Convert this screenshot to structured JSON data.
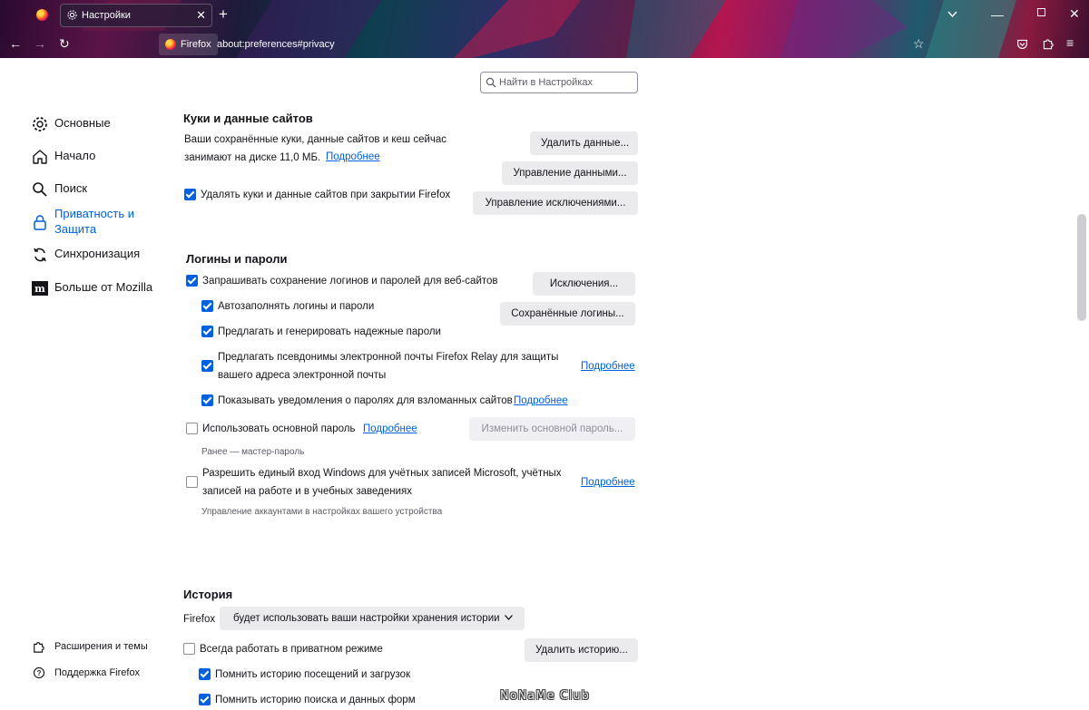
{
  "browser": {
    "tab_title": "Настройки",
    "identity_label": "Firefox",
    "url": "about:preferences#privacy"
  },
  "sidebar": {
    "items": [
      {
        "label": "Основные",
        "icon": "gear-icon"
      },
      {
        "label": "Начало",
        "icon": "home-icon"
      },
      {
        "label": "Поиск",
        "icon": "search-icon"
      },
      {
        "label": "Приватность и\nЗащита",
        "icon": "lock-icon",
        "selected": true
      },
      {
        "label": "Синхронизация",
        "icon": "sync-icon"
      },
      {
        "label": "Больше от Mozilla",
        "icon": "mozilla-icon"
      }
    ],
    "footer": [
      {
        "label": "Расширения и темы",
        "icon": "puzzle-icon"
      },
      {
        "label": "Поддержка Firefox",
        "icon": "help-icon"
      }
    ]
  },
  "search": {
    "placeholder": "Найти в Настройках"
  },
  "cookies": {
    "heading": "Куки и данные сайтов",
    "usage_line1": "Ваши сохранённые куки, данные сайтов и кеш сейчас",
    "usage_line2": "занимают на диске 11,0 МБ.",
    "learn_more": "Подробнее",
    "clear_data_button": "Удалить данные...",
    "manage_data_button": "Управление данными...",
    "manage_exceptions_button": "Управление исключениями...",
    "delete_on_close_label": "Удалять куки и данные сайтов при закрытии Firefox",
    "delete_on_close_checked": true
  },
  "logins": {
    "heading": "Логины и пароли",
    "ask_to_save_label": "Запрашивать сохранение логинов и паролей для веб-сайтов",
    "ask_to_save_checked": true,
    "exceptions_button": "Исключения...",
    "autofill_label": "Автозаполнять логины и пароли",
    "autofill_checked": true,
    "saved_logins_button": "Сохранённые логины...",
    "generate_label": "Предлагать и генерировать надежные пароли",
    "generate_checked": true,
    "relay_line1": "Предлагать псевдонимы электронной почты Firefox Relay для защиты",
    "relay_line2": "вашего адреса электронной почты",
    "relay_checked": true,
    "relay_learn_more": "Подробнее",
    "breach_label": "Показывать уведомления о паролях для взломанных сайтов",
    "breach_checked": true,
    "breach_learn_more": "Подробнее",
    "primary_password_label": "Использовать основной пароль",
    "primary_password_checked": false,
    "primary_password_learn_more": "Подробнее",
    "change_primary_button": "Изменить основной пароль...",
    "primary_password_note": "Ранее — мастер-пароль",
    "windows_sso_line1": "Разрешить единый вход Windows для учётных записей Microsoft, учётных",
    "windows_sso_line2": "записей на работе и в учебных заведениях",
    "windows_sso_checked": false,
    "windows_sso_learn_more": "Подробнее",
    "windows_sso_note": "Управление аккаунтами в настройках вашего устройства"
  },
  "history": {
    "heading": "История",
    "firefox_label": "Firefox",
    "mode_value": "будет использовать ваши настройки хранения истории",
    "private_label": "Всегда работать в приватном режиме",
    "private_checked": false,
    "clear_history_button": "Удалить историю...",
    "remember_browsing_label": "Помнить историю посещений и загрузок",
    "remember_browsing_checked": true,
    "remember_search_label": "Помнить историю поиска и данных форм",
    "remember_search_checked": true
  },
  "watermark": "NoNaMe Club",
  "colors": {
    "accent": "#0061e0",
    "button_bg": "#ebebee",
    "text": "#15141a"
  }
}
